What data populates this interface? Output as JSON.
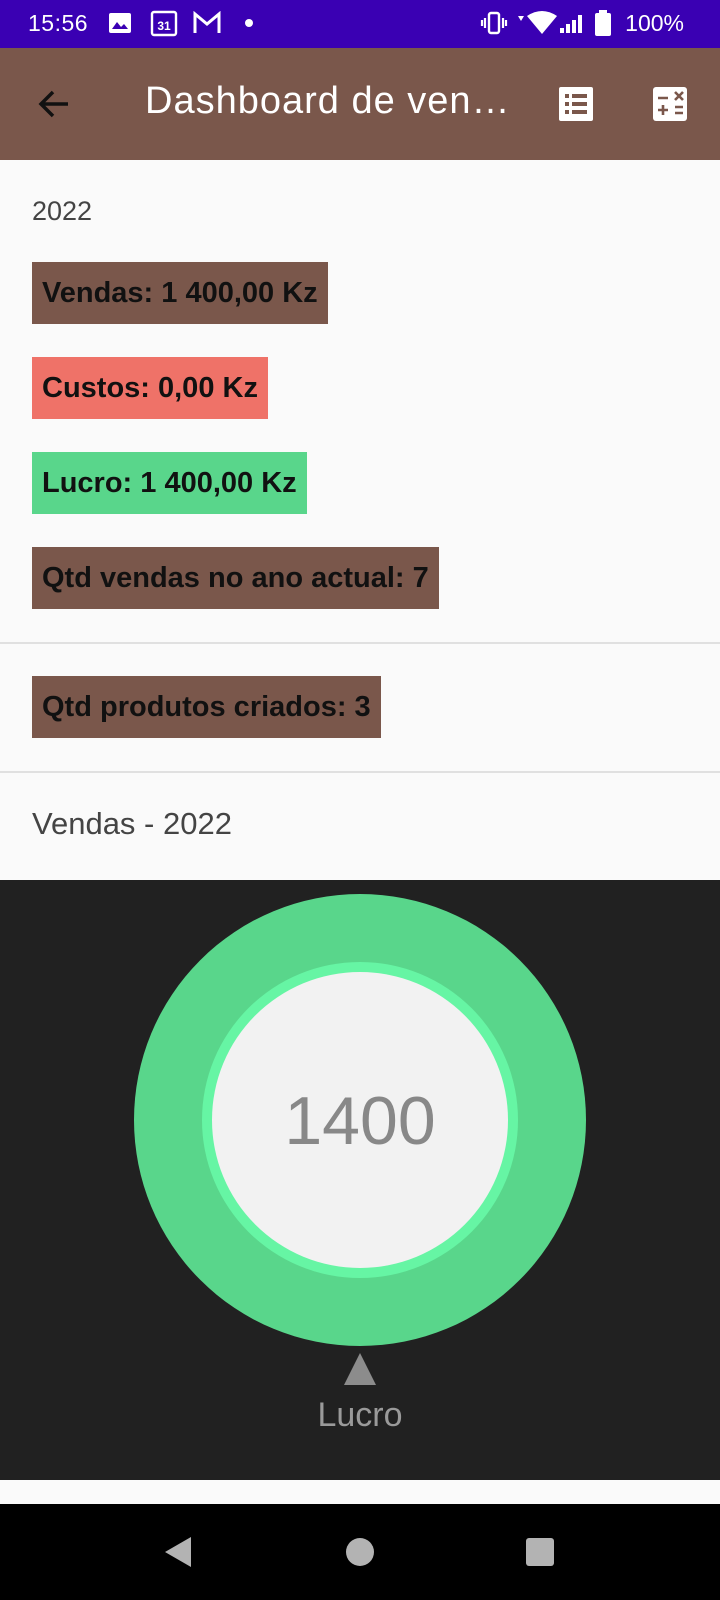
{
  "status_bar": {
    "time": "15:56",
    "battery": "100%",
    "icons": [
      "image-icon",
      "calendar-icon",
      "gmail-icon",
      "dot-icon",
      "vibrate-icon",
      "wifi-icon",
      "signal-icon",
      "battery-icon"
    ],
    "calendar_day": "31",
    "background": "#3a00b3"
  },
  "app_bar": {
    "title": "Dashboard de ven…",
    "background": "#7a574b",
    "icons": [
      "back-arrow-icon",
      "list-icon",
      "calculator-icon"
    ]
  },
  "summary": {
    "year": "2022",
    "sales": "Vendas: 1 400,00 Kz",
    "costs": "Custos: 0,00 Kz",
    "profit": "Lucro: 1 400,00 Kz",
    "sales_count": "Qtd vendas no ano actual: 7"
  },
  "products": {
    "created_count": "Qtd produtos criados: 3"
  },
  "chart_section": {
    "title": "Vendas - 2022"
  },
  "chart_data": {
    "type": "pie",
    "center_text": "1400",
    "series": [
      {
        "name": "Lucro",
        "value": 1400,
        "color": "#59d68b"
      }
    ],
    "legend": [
      "Lucro"
    ],
    "background": "#212121"
  },
  "nav_bar": {
    "icons": [
      "back-triangle-icon",
      "home-circle-icon",
      "recents-square-icon"
    ]
  }
}
